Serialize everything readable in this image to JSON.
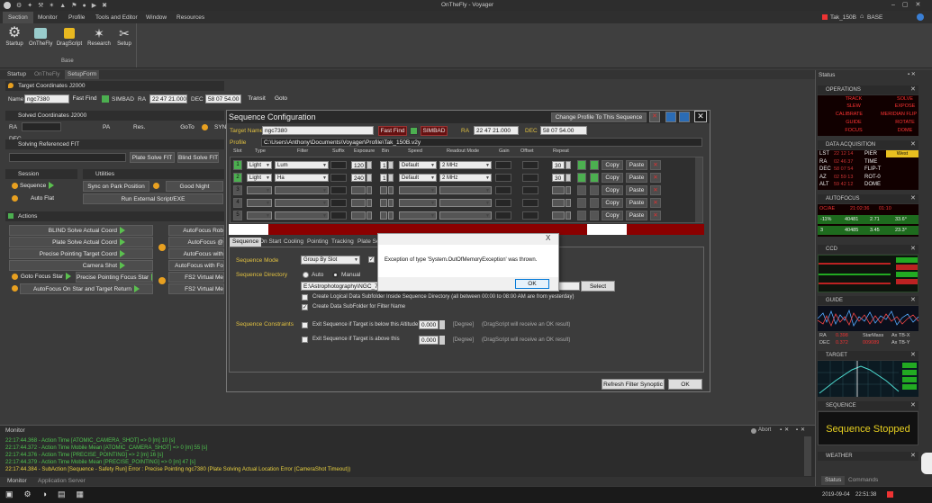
{
  "titlebar": {
    "title": "OnTheFly - Voyager"
  },
  "menu": {
    "items": [
      "Section",
      "Monitor",
      "Profile",
      "Tools and Editor",
      "Window",
      "Resources"
    ],
    "profile": "Tak_150B",
    "base": "BASE"
  },
  "ribbon": {
    "buttons": [
      "Startup",
      "OnTheFly",
      "DragScript",
      "Research",
      "Setup"
    ],
    "group": "Base"
  },
  "left_tabs": [
    "Startup",
    "OnTheFly",
    "SetupForm"
  ],
  "target": {
    "header": "Target Coordinates J2000",
    "name_label": "Name",
    "name": "ngc7380",
    "fast_find": "Fast Find",
    "simbad": "SIMBAD",
    "ra_label": "RA",
    "ra": "22 47 21.000",
    "dec_label": "DEC",
    "dec": "58 07 54.00",
    "transit": "Transit",
    "goto": "Goto"
  },
  "solved": {
    "header": "Solved Coordinates J2000",
    "ra": "RA",
    "pa": "PA",
    "res": "Res.",
    "dec_label": "DEC",
    "goto": "GoTo",
    "sync": "SYN"
  },
  "solving": {
    "header": "Solving Referenced FIT",
    "plate_solve": "Plate Solve FIT",
    "blind_solve": "Blind Solve FIT"
  },
  "session": {
    "header": "Session",
    "sequence": "Sequence",
    "auto_flat": "Auto Flat"
  },
  "utilities": {
    "header": "Utilities",
    "sync_park": "Sync on Park Position",
    "good_night": "Good Night",
    "run_script": "Run External Script/EXE"
  },
  "actions": {
    "header": "Actions",
    "left": [
      "BLIND Solve Actual Coord",
      "Plate Solve Actual Coord",
      "Precise Pointing Target Coord",
      "Camera Shot"
    ],
    "goto_focus": "Goto Focus Star",
    "precise_focus": "Precise Pointing Focus Star",
    "af_target": "AutoFocus On Star and Target Return",
    "right": [
      "AutoFocus Rob",
      "AutoFocus @",
      "AutoFocus with",
      "AutoFocus with Fo",
      "FS2 Virtual Me",
      "FS2 Virtual Me"
    ]
  },
  "monitor": {
    "title": "Monitor",
    "abort": "Abort",
    "lines": [
      "22:17:44.368 - Action Time [ATOMIC_CAMERA_SHOT] => 0 [m] 10 [s]",
      "22:17:44.372 - Action Time Mobile Mean [ATOMIC_CAMERA_SHOT] => 0 [m] 55 [s]",
      "22:17:44.376 - Action Time [PRECISE_POINTING] => 2 [m] 16 [s]",
      "22:17:44.379 - Action Time Mobile Mean [PRECISE_POINTING] => 0 [m] 47 [s]",
      "22:17:44.384 - SubAction [Sequence - Safety Run] Error : Precise Pointing ngc7380 (Plate Solving Actual Location Error (CameraShot Timeout))"
    ],
    "tabs": [
      "Monitor",
      "Application Server"
    ]
  },
  "status": {
    "title": "Status",
    "tabs": [
      "Status",
      "Commands"
    ],
    "date": "2019-09-04",
    "time": "22:51:38"
  },
  "panels": {
    "operations": "OPERATIONS",
    "ops": [
      "TRACK",
      "SOLVE",
      "SLEW",
      "EXPOSE",
      "CALIBRATE",
      "MERIDIAN FLIP",
      "GUIDE",
      "ROTATE",
      "FOCUS",
      "DOME"
    ],
    "data_acq": "DATA ACQUISITION",
    "acq_left": [
      "LST",
      "RA",
      "DEC",
      "AZ",
      "ALT"
    ],
    "acq_mid": [
      "PIER",
      "TIME",
      "FLIP-T",
      "ROT-0",
      "DOME"
    ],
    "acq_vals": [
      "22 12 14",
      "02 46 37",
      "58 07 54",
      "02 59 13",
      "59 42 12"
    ],
    "acq_flag": "West",
    "autofocus": "AUTOFOCUS",
    "af_row1": [
      "OC/AE",
      "21:02:36",
      "01:10"
    ],
    "af_row2": [
      "-11%",
      "40481",
      "2.71",
      "33.6°"
    ],
    "af_row3": [
      "3",
      "40485",
      "3.45",
      "23.3°"
    ],
    "ccd": "CCD",
    "guide": "GUIDE",
    "guide_ra": "RA",
    "guide_dec": "DEC",
    "guide_vals": [
      "0.398",
      "0.372",
      "StarMass",
      "009089",
      "Ax TB-X",
      "Ax TB-Y"
    ],
    "target": "TARGET",
    "sequence": "SEQUENCE",
    "seq_status": "Sequence Stopped",
    "weather": "WEATHER"
  },
  "dialog": {
    "title": "Sequence Configuration",
    "change_profile": "Change Profile To This Sequence",
    "target_name_label": "Target Name",
    "target_name": "ngc7380",
    "fast_find": "Fast Find",
    "simbad": "SIMBAD",
    "ra_label": "RA",
    "ra": "22 47 21.000",
    "dec_label": "DEC",
    "dec": "58 07 54.00",
    "profile_label": "Profile",
    "profile": "C:\\Users\\Anthony\\Documents\\Voyager\\Profile\\Tak_150B.v2y",
    "columns": [
      "Slot",
      "Type",
      "Filter",
      "Suffix",
      "Exposure",
      "Bin",
      "Speed",
      "Readout Mode",
      "Gain",
      "Offset",
      "Repeat"
    ],
    "slots": [
      {
        "n": "1",
        "type": "Light",
        "filter": "Lum",
        "exp": "120",
        "bin": "1",
        "speed": "Default",
        "readout": "2 MHz",
        "repeat": "30",
        "copy": "Copy",
        "paste": "Paste"
      },
      {
        "n": "2",
        "type": "Light",
        "filter": "Ha",
        "exp": "240",
        "bin": "1",
        "speed": "Default",
        "readout": "2 MHz",
        "repeat": "30",
        "copy": "Copy",
        "paste": "Paste"
      },
      {
        "n": "3",
        "type": "",
        "filter": "",
        "exp": "",
        "bin": "",
        "speed": "",
        "readout": "",
        "repeat": "",
        "copy": "Copy",
        "paste": "Paste"
      },
      {
        "n": "4",
        "type": "",
        "filter": "",
        "exp": "",
        "bin": "",
        "speed": "",
        "readout": "",
        "repeat": "",
        "copy": "Copy",
        "paste": "Paste"
      },
      {
        "n": "5",
        "type": "",
        "filter": "",
        "exp": "",
        "bin": "",
        "speed": "",
        "readout": "",
        "repeat": "",
        "copy": "Copy",
        "paste": "Paste"
      }
    ],
    "tabs": [
      "Sequence",
      "On Start",
      "Cooling",
      "Pointing",
      "Tracking",
      "Plate So"
    ],
    "seq_mode_label": "Sequence Mode",
    "seq_mode": "Group By Slot",
    "seq_dir_label": "Sequence Directory",
    "auto": "Auto",
    "manual": "Manual",
    "dir": "E:\\Astrophotography\\NGC_7380",
    "select": "Select",
    "chk_logical": "Create Logical Data Subfolder Inside Sequence Directory (all between 00:00 to 08:00 AM are from yesterday)",
    "chk_filter": "Create Data SubFolder for Filter Name",
    "constraints_label": "Sequence Constraints",
    "c1": "Exit Sequence if Target is below this Altitude",
    "c2": "Exit Sequence if Target is above this",
    "c1_val": "0.000",
    "c2_val": "0.000",
    "degree": "[Degree]",
    "c1_note": "(DragScript will receive an OK result)",
    "c2_note": "(DragScript will receive an OK result)",
    "refresh": "Refresh Filter Synoptic",
    "ok": "OK"
  },
  "msgbox": {
    "text": "Exception of type 'System.OutOfMemoryException' was thrown.",
    "ok": "OK",
    "close": "X"
  }
}
